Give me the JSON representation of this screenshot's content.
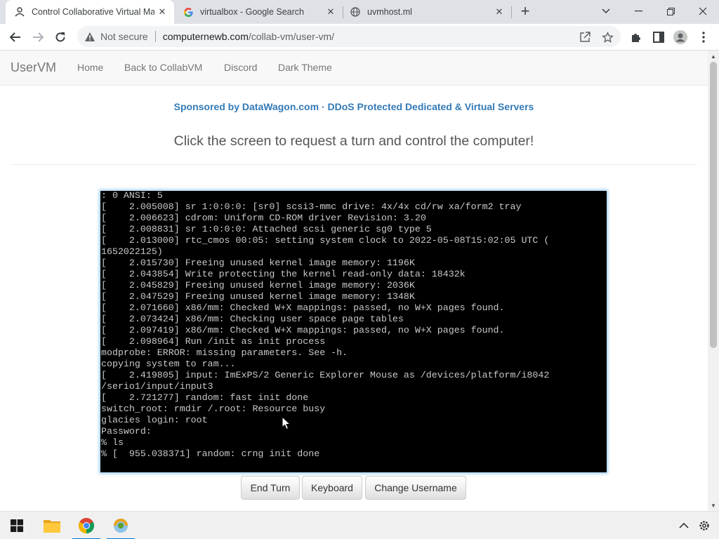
{
  "browser": {
    "tabs": [
      {
        "title": "Control Collaborative Virtual Ma",
        "icon": "user-icon",
        "active": true
      },
      {
        "title": "virtualbox - Google Search",
        "icon": "google-icon",
        "active": false
      },
      {
        "title": "uvmhost.ml",
        "icon": "globe-icon",
        "active": false
      }
    ],
    "security_label": "Not secure",
    "url_host": "computernewb.com",
    "url_path": "/collab-vm/user-vm/"
  },
  "site": {
    "brand": "UserVM",
    "nav": [
      "Home",
      "Back to CollabVM",
      "Discord",
      "Dark Theme"
    ],
    "sponsor": "Sponsored by DataWagon.com · DDoS Protected Dedicated & Virtual Servers",
    "headline": "Click the screen to request a turn and control the computer!"
  },
  "terminal": {
    "lines": [
      ": 0 ANSI: 5",
      "[    2.005008] sr 1:0:0:0: [sr0] scsi3-mmc drive: 4x/4x cd/rw xa/form2 tray",
      "[    2.006623] cdrom: Uniform CD-ROM driver Revision: 3.20",
      "[    2.008831] sr 1:0:0:0: Attached scsi generic sg0 type 5",
      "[    2.013000] rtc_cmos 00:05: setting system clock to 2022-05-08T15:02:05 UTC (",
      "1652022125)",
      "[    2.015730] Freeing unused kernel image memory: 1196K",
      "[    2.043854] Write protecting the kernel read-only data: 18432k",
      "[    2.045829] Freeing unused kernel image memory: 2036K",
      "[    2.047529] Freeing unused kernel image memory: 1348K",
      "[    2.071660] x86/mm: Checked W+X mappings: passed, no W+X pages found.",
      "[    2.073424] x86/mm: Checking user space page tables",
      "[    2.097419] x86/mm: Checked W+X mappings: passed, no W+X pages found.",
      "[    2.098964] Run /init as init process",
      "modprobe: ERROR: missing parameters. See -h.",
      "copying system to ram...",
      "[    2.419805] input: ImExPS/2 Generic Explorer Mouse as /devices/platform/i8042",
      "/serio1/input/input3",
      "[    2.721277] random: fast init done",
      "switch_root: rmdir /.root: Resource busy",
      "glacies login: root",
      "Password:",
      "% ls",
      "% [  955.038371] random: crng init done"
    ]
  },
  "controls": {
    "end_turn": "End Turn",
    "keyboard": "Keyboard",
    "change_username": "Change Username"
  },
  "colors": {
    "link": "#337ab7",
    "navbar_bg": "#f8f8f8",
    "terminal_bg": "#000000",
    "terminal_fg": "#c8c8c8"
  }
}
